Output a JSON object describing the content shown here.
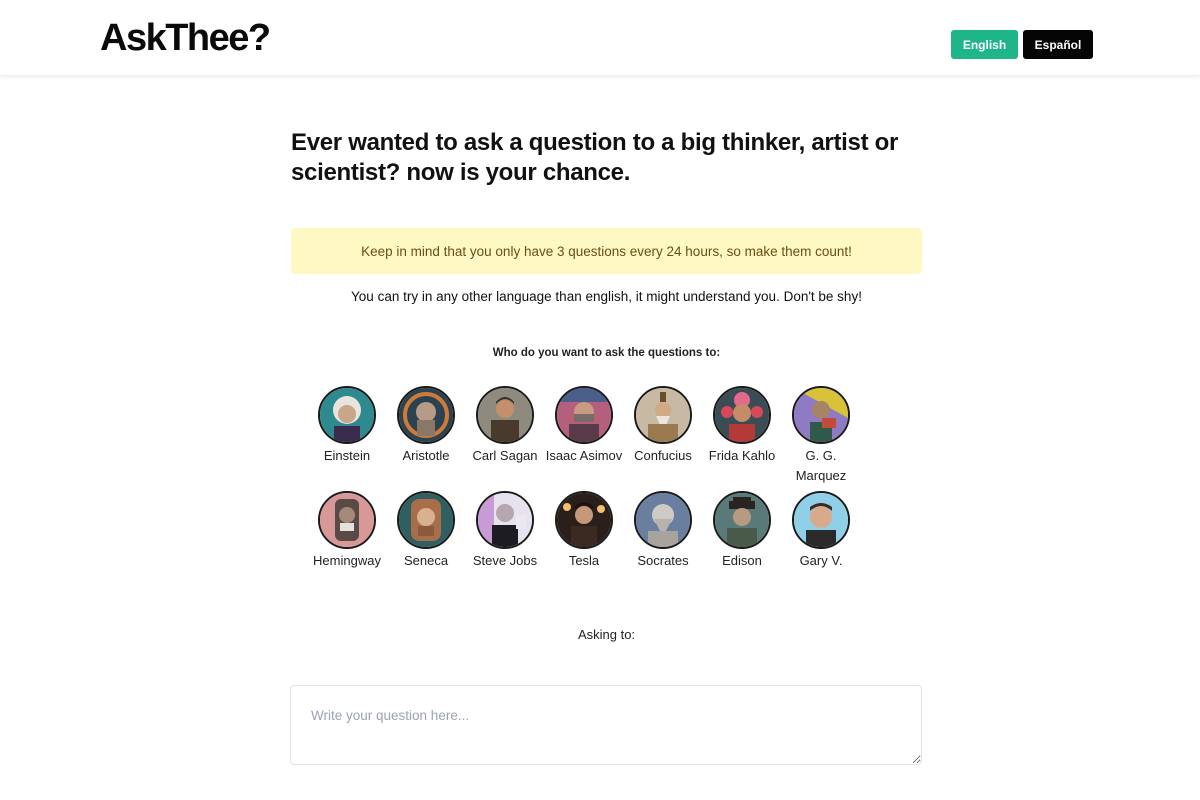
{
  "header": {
    "logo": "AskThee?",
    "lang_english": "English",
    "lang_spanish": "Español",
    "accent_color": "#1eb589"
  },
  "main": {
    "headline": "Ever wanted to ask a question to a big thinker, artist or scientist? now is your chance.",
    "notice": "Keep in mind that you only have 3 questions every 24 hours, so make them count!",
    "language_hint": "You can try in any other language than english, it might understand you. Don't be shy!",
    "who_label": "Who do you want to ask the questions to:",
    "thinkers": [
      {
        "name": "Einstein"
      },
      {
        "name": "Aristotle"
      },
      {
        "name": "Carl Sagan"
      },
      {
        "name": "Isaac Asimov"
      },
      {
        "name": "Confucius"
      },
      {
        "name": "Frida Kahlo"
      },
      {
        "name": "G. G. Marquez"
      },
      {
        "name": "Hemingway"
      },
      {
        "name": "Seneca"
      },
      {
        "name": "Steve Jobs"
      },
      {
        "name": "Tesla"
      },
      {
        "name": "Socrates"
      },
      {
        "name": "Edison"
      },
      {
        "name": "Gary V."
      }
    ],
    "asking_label": "Asking to:",
    "question_placeholder": "Write your question here..."
  }
}
